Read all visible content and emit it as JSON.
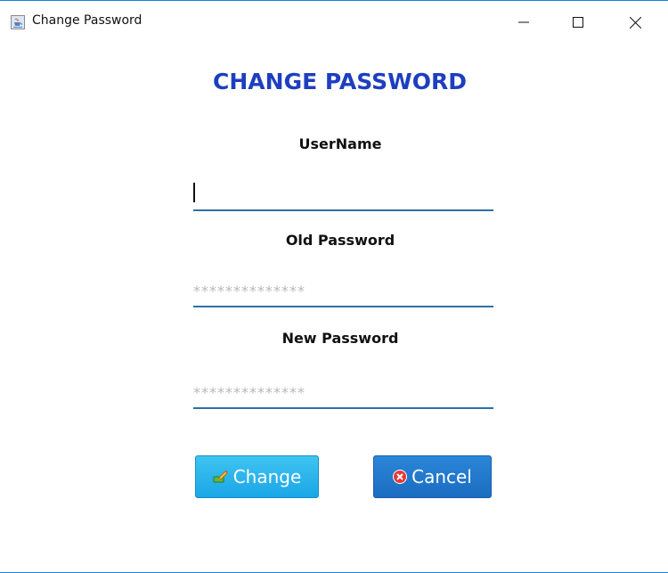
{
  "window": {
    "title": "Change Password",
    "icon": "java-cup-icon",
    "accent_color": "#1883d7"
  },
  "heading": "CHANGE PASSWORD",
  "heading_color": "#1d3fbf",
  "fields": {
    "username": {
      "label": "UserName",
      "value": "",
      "placeholder": ""
    },
    "old_password": {
      "label": "Old Password",
      "value": "",
      "placeholder": "**************"
    },
    "new_password": {
      "label": "New Password",
      "value": "",
      "placeholder": "**************"
    }
  },
  "buttons": {
    "change": {
      "label": "Change",
      "icon": "key-pencil-icon",
      "color": "#1aa6e6"
    },
    "cancel": {
      "label": "Cancel",
      "icon": "close-circle-icon",
      "color": "#1b6cc1"
    }
  }
}
